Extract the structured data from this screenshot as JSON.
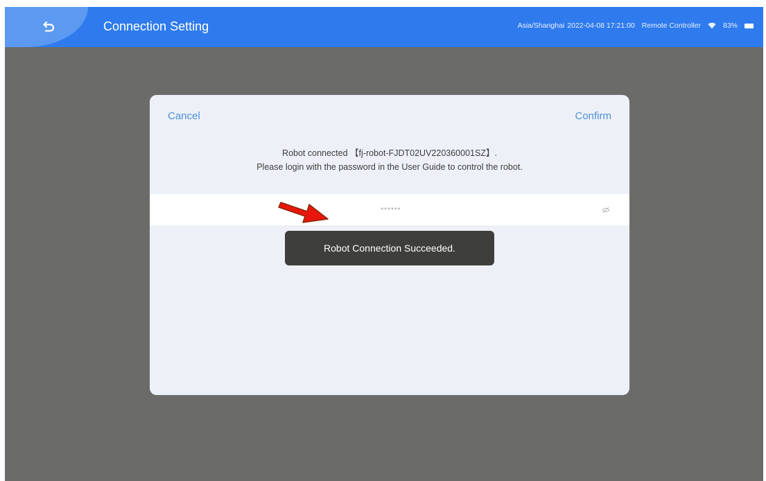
{
  "header": {
    "title": "Connection Setting",
    "timezone": "Asia/Shanghai",
    "datetime": "2022-04-08 17:21:00",
    "controller_label": "Remote Controller",
    "battery": "83%",
    "back_icon": "back-arrow-icon",
    "wifi_icon": "wifi-icon",
    "battery_icon": "battery-icon",
    "accent_color": "#2f7bee"
  },
  "dialog": {
    "cancel_label": "Cancel",
    "confirm_label": "Confirm",
    "message_line1": "Robot connected 【fj-robot-FJDT02UV220360001SZ】.",
    "message_line2": "Please login with the password in the User Guide to control the robot.",
    "password_value": "******",
    "eye_icon": "eye-icon"
  },
  "toast": {
    "text": "Robot Connection Succeeded."
  },
  "annotation": {
    "arrow_icon": "red-arrow-icon",
    "arrow_color": "#e8160c"
  }
}
